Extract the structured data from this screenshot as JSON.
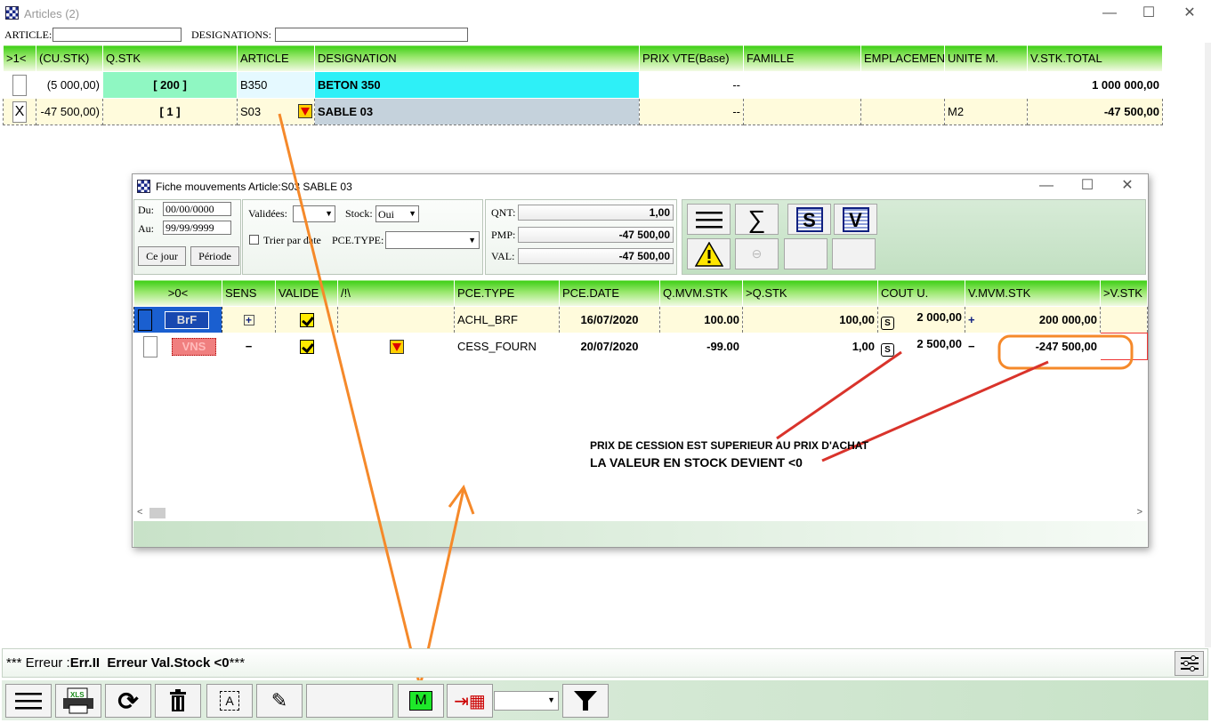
{
  "main": {
    "title": "Articles (2)",
    "filters": {
      "article_label": "ARTICLE:",
      "designations_label": "DESIGNATIONS:"
    },
    "columns": [
      ">1<",
      "(CU.STK)",
      "Q.STK",
      "ARTICLE",
      "DESIGNATION",
      "PRIX VTE(Base)",
      "FAMILLE",
      "EMPLACEMEN",
      "UNITE M.",
      "V.STK.TOTAL"
    ],
    "rows": [
      {
        "sel": "",
        "cu_stk": "(5 000,00)",
        "q_stk": "[ 200 ]",
        "article": "B350",
        "designation": "BETON 350",
        "prix_vte": "--",
        "famille": "",
        "emplacement": "",
        "unite": "",
        "v_stk_total": "1 000 000,00"
      },
      {
        "sel": "X",
        "cu_stk": "-47 500,00)",
        "q_stk": "[ 1 ]",
        "article": "S03",
        "designation": "SABLE 03",
        "prix_vte": "--",
        "famille": "",
        "emplacement": "",
        "unite": "M2",
        "v_stk_total": "-47 500,00"
      }
    ]
  },
  "child": {
    "title": "Fiche mouvements Article:S03 SABLE 03",
    "du_label": "Du:",
    "du_value": "00/00/0000",
    "au_label": "Au:",
    "au_value": "99/99/9999",
    "ce_jour": "Ce jour",
    "periode": "Période",
    "validees_label": "Validées:",
    "validees_value": "",
    "stock_label": "Stock:",
    "stock_value": "Oui",
    "trier_label": "Trier par date",
    "pce_type_label": "PCE.TYPE:",
    "pce_type_value": "",
    "qnt_label": "QNT:",
    "qnt_value": "1,00",
    "pmp_label": "PMP:",
    "pmp_value": "-47 500,00",
    "val_label": "VAL:",
    "val_value": "-47 500,00",
    "columns": [
      ">0<",
      "SENS",
      "VALIDE",
      "/!\\",
      "PCE.TYPE",
      "PCE.DATE",
      "Q.MVM.STK",
      ">Q.STK",
      "COUT U.",
      "V.MVM.STK",
      ">V.STK"
    ],
    "rows": [
      {
        "badge": "BrF",
        "sens": "+",
        "pce_type": "ACHL_BRF",
        "pce_date": "16/07/2020",
        "q_mvm": "100.00",
        "q_stk": "100,00",
        "cout_s": "S",
        "cout": "2 000,00",
        "vmvm_sign": "+",
        "v_mvm": "200 000,00",
        "v_stk": ""
      },
      {
        "badge": "VNS",
        "sens": "−",
        "pce_type": "CESS_FOURN",
        "pce_date": "20/07/2020",
        "q_mvm": "-99.00",
        "q_stk": "1,00",
        "cout_s": "S",
        "cout": "2 500,00",
        "vmvm_sign": "−",
        "v_mvm": "-247 500,00",
        "v_stk": ""
      }
    ]
  },
  "annotations": {
    "line1": "PRIX DE CESSION EST SUPERIEUR AU PRIX D'ACHAT",
    "line2": "LA VALEUR EN STOCK DEVIENT <0"
  },
  "status": {
    "prefix": "*** Erreur :",
    "code": "Err.II",
    "message": "Erreur Val.Stock <0",
    "suffix": "***"
  },
  "toolbar": {
    "m_label": "M",
    "xls_label": "XLS"
  },
  "colors": {
    "header_green": "#3ccf14",
    "annot_orange": "#f5892a",
    "annot_red": "#d9332b",
    "q_stk_green": "#8ff7c2",
    "designation_cyan": "#2ef0f7"
  }
}
